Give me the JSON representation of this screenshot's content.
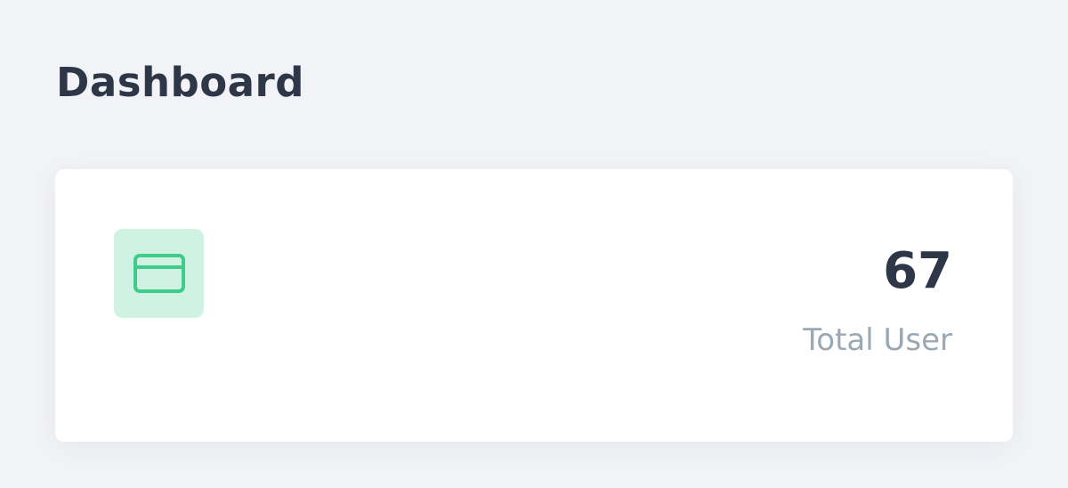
{
  "header": {
    "title": "Dashboard"
  },
  "stat_card": {
    "icon": "credit-card-icon",
    "value": "67",
    "label": "Total User"
  },
  "colors": {
    "background": "#f2f3f7",
    "card": "#ffffff",
    "title_text": "#2d3748",
    "label_text": "#9aa8b4",
    "icon_bg": "#d0f2e3",
    "icon_stroke": "#3ecb8b"
  }
}
